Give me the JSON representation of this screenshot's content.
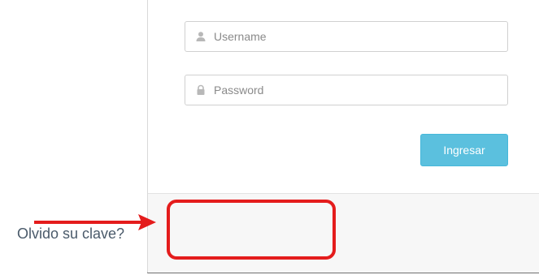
{
  "login_form": {
    "username": {
      "placeholder": "Username",
      "value": "",
      "icon": "user-icon"
    },
    "password": {
      "placeholder": "Password",
      "value": "",
      "icon": "lock-icon"
    },
    "submit_label": "Ingresar",
    "forgot_link_text": "Olvido su clave?"
  },
  "annotation": {
    "color": "#e41c1c",
    "arrow_icon": "arrow-right-icon"
  },
  "colors": {
    "button_bg": "#5bc0de",
    "link_text": "#4a5a6a"
  }
}
